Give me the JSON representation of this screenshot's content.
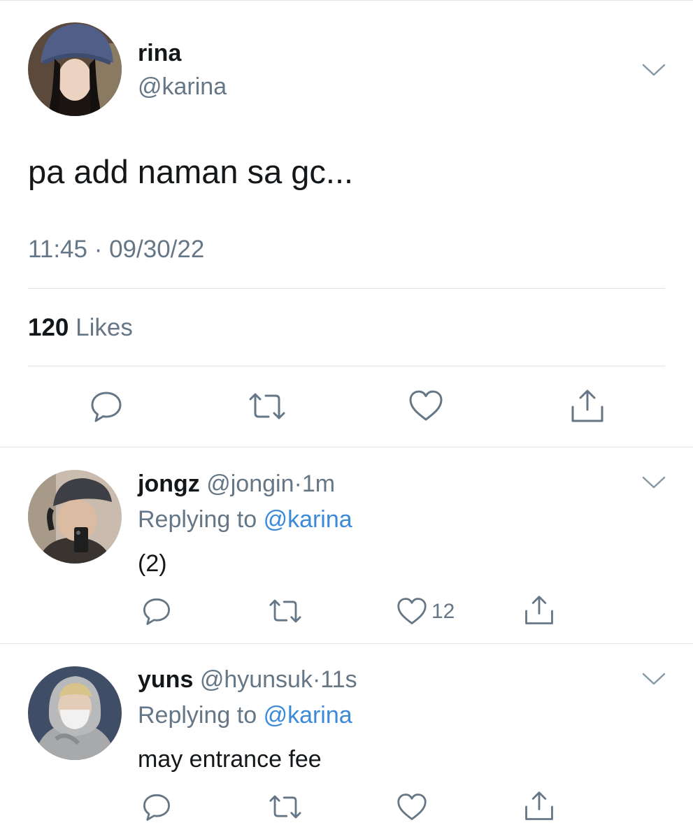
{
  "main_tweet": {
    "name": "rina",
    "handle": "@karina",
    "text": "pa add naman sa gc...",
    "timestamp": "11:45 · 09/30/22",
    "likes_count": "120",
    "likes_label": "Likes"
  },
  "replies": [
    {
      "name": "jongz",
      "handle": "@jongin",
      "dot": "·",
      "time": "1m",
      "replying_prefix": "Replying to",
      "replying_to": "@karina",
      "text": "(2)",
      "like_count": "12"
    },
    {
      "name": "yuns",
      "handle": "@hyunsuk",
      "dot": "·",
      "time": "11s",
      "replying_prefix": "Replying to",
      "replying_to": "@karina",
      "text": "may entrance fee",
      "like_count": ""
    }
  ],
  "icons": {
    "reply": "reply-icon",
    "retweet": "retweet-icon",
    "like": "heart-icon",
    "share": "share-icon",
    "more": "chevron-down-icon"
  },
  "colors": {
    "text": "#14171a",
    "secondary": "#657786",
    "link": "#3a8ad9",
    "divider": "#e1e8ed"
  }
}
